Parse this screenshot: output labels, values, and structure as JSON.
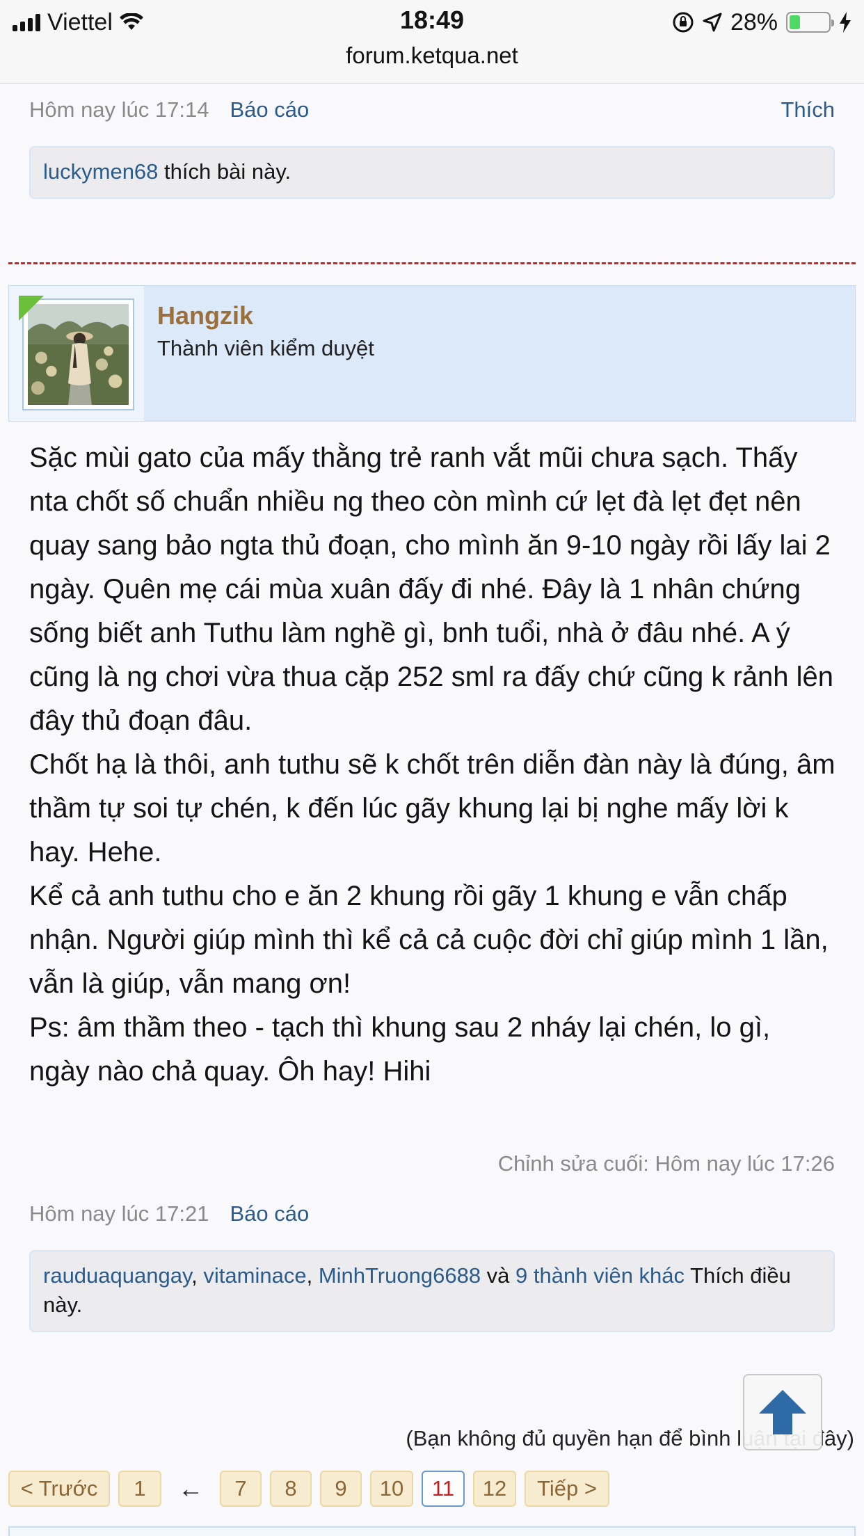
{
  "status_bar": {
    "carrier": "Viettel",
    "time": "18:49",
    "battery": "28%",
    "battery_level": 0.28
  },
  "url": "forum.ketqua.net",
  "prev_post": {
    "time": "Hôm nay lúc 17:14",
    "report_label": "Báo cáo",
    "like_label": "Thích",
    "likes": {
      "user": "luckymen68",
      "suffix": " thích bài này."
    }
  },
  "post": {
    "author": {
      "name": "Hangzik",
      "title": "Thành viên kiểm duyệt"
    },
    "message_paragraphs": [
      "Sặc mùi gato của mấy thằng trẻ ranh vắt mũi chưa sạch. Thấy nta chốt số chuẩn nhiều ng theo còn mình cứ lẹt đà lẹt đẹt nên quay sang bảo ngta thủ đoạn, cho mình ăn 9-10 ngày rồi lấy lai 2 ngày. Quên mẹ cái mùa xuân đấy đi nhé. Đây là 1 nhân chứng sống biết anh Tuthu làm nghề gì, bnh tuổi, nhà ở đâu nhé. A ý cũng là ng chơi vừa thua cặp 252 sml ra đấy chứ cũng k rảnh lên đây thủ đoạn đâu.",
      "Chốt hạ là thôi, anh tuthu sẽ k chốt trên diễn đàn này là đúng, âm thầm tự soi tự chén, k đến lúc gãy khung lại bị nghe mấy lời k hay. Hehe.",
      "Kể cả anh tuthu cho e ăn 2 khung rồi gãy 1 khung e vẫn chấp nhận. Người giúp mình thì kể cả cả cuộc đời chỉ giúp mình 1 lần, vẫn là giúp, vẫn mang ơn!",
      "Ps: âm thầm theo - tạch thì khung sau 2 nháy lại chén, lo gì, ngày nào chả quay. Ôh hay! Hihi"
    ],
    "last_edited": "Chỉnh sửa cuối: Hôm nay lúc 17:26",
    "time": "Hôm nay lúc 17:21",
    "report_label": "Báo cáo",
    "likes": {
      "users": [
        "rauduaquangay",
        "vitaminace",
        "MinhTruong6688"
      ],
      "sep": ", ",
      "and": " và ",
      "others": "9 thành viên khác",
      "suffix": " Thích điều này."
    }
  },
  "permission_note": "(Bạn không đủ quyền hạn để bình luận tại đây)",
  "pagination": {
    "prev": "< Trước",
    "first": "1",
    "separator": "←",
    "pages": [
      "7",
      "8",
      "9",
      "10",
      "11",
      "12"
    ],
    "current": "11",
    "next": "Tiếp >"
  },
  "colors": {
    "link": "#2a5b8b",
    "author": "#9b6f3a",
    "divider": "#cc2222",
    "current_page": "#c61f1f",
    "scroll_arrow": "#2d6aa6"
  }
}
